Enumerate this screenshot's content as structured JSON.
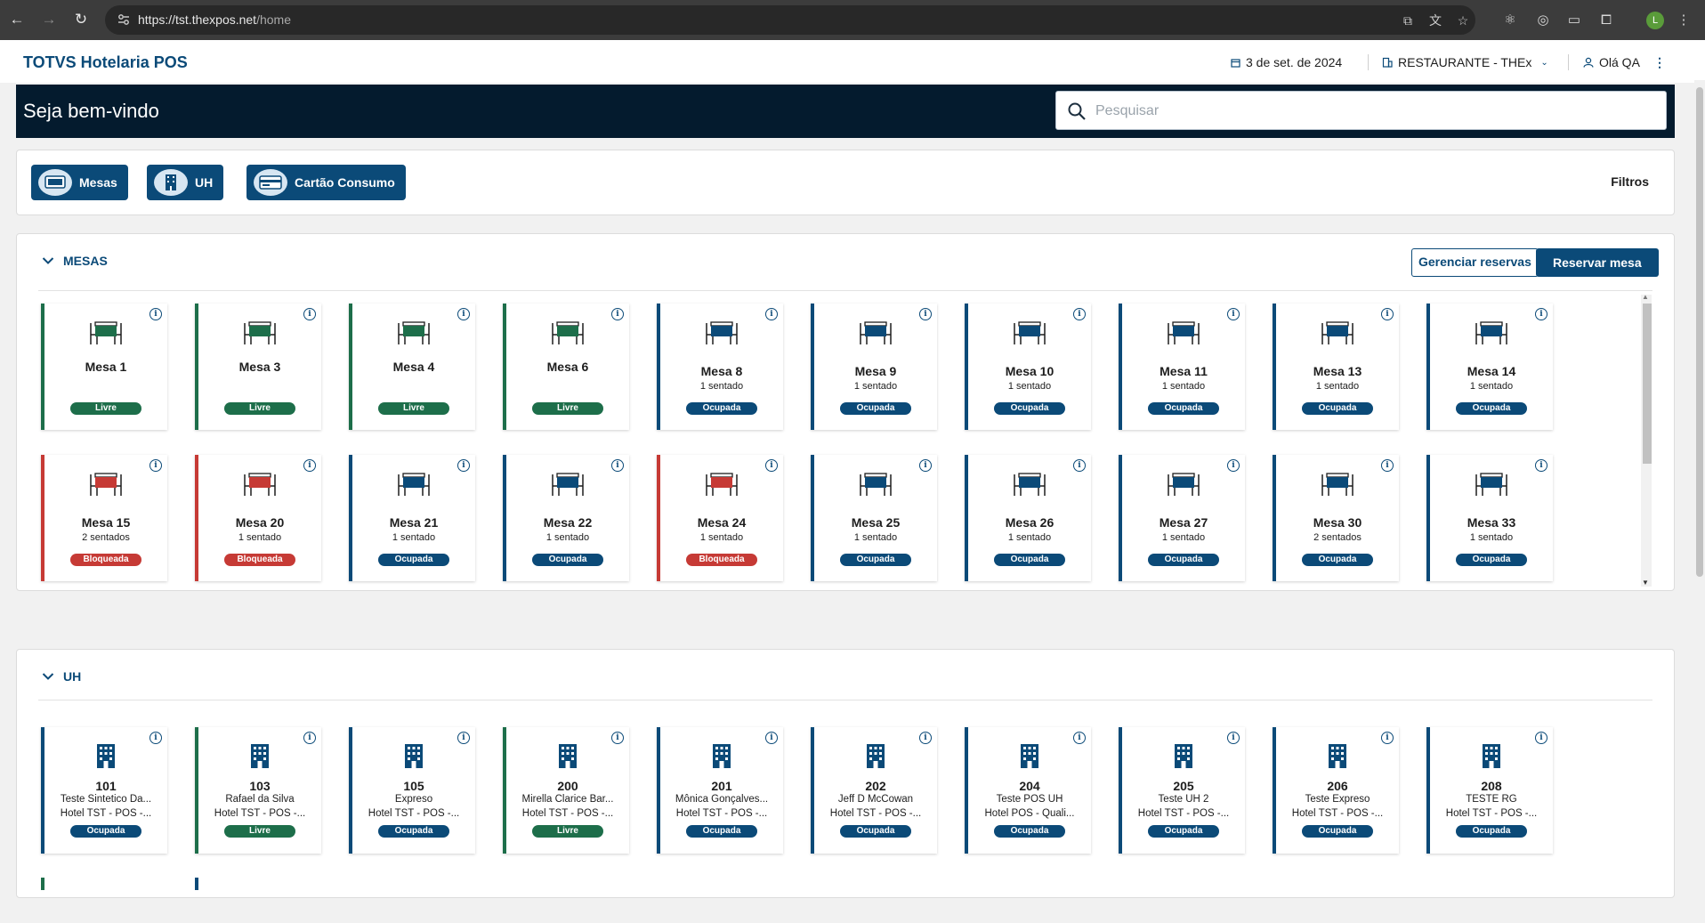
{
  "browser": {
    "url_host": "https://tst.thexpos.net",
    "url_path": "/home",
    "avatar_letter": "L"
  },
  "topbar": {
    "brand": "TOTVS Hotelaria POS",
    "date": "3 de set. de 2024",
    "location": "RESTAURANTE - THEx",
    "user": "Olá QA"
  },
  "banner": {
    "title": "Seja bem-vindo",
    "search_placeholder": "Pesquisar"
  },
  "filters": {
    "buttons": [
      "Mesas",
      "UH",
      "Cartão Consumo"
    ],
    "filtros_label": "Filtros"
  },
  "mesas": {
    "section_title": "MESAS",
    "manage_label": "Gerenciar reservas",
    "reserve_label": "Reservar mesa",
    "cards": [
      {
        "name": "Mesa 1",
        "sub": "",
        "status": "Livre",
        "kind": "livre"
      },
      {
        "name": "Mesa 3",
        "sub": "",
        "status": "Livre",
        "kind": "livre"
      },
      {
        "name": "Mesa 4",
        "sub": "",
        "status": "Livre",
        "kind": "livre"
      },
      {
        "name": "Mesa 6",
        "sub": "",
        "status": "Livre",
        "kind": "livre"
      },
      {
        "name": "Mesa 8",
        "sub": "1 sentado",
        "status": "Ocupada",
        "kind": "ocupada"
      },
      {
        "name": "Mesa 9",
        "sub": "1 sentado",
        "status": "Ocupada",
        "kind": "ocupada"
      },
      {
        "name": "Mesa 10",
        "sub": "1 sentado",
        "status": "Ocupada",
        "kind": "ocupada"
      },
      {
        "name": "Mesa 11",
        "sub": "1 sentado",
        "status": "Ocupada",
        "kind": "ocupada"
      },
      {
        "name": "Mesa 13",
        "sub": "1 sentado",
        "status": "Ocupada",
        "kind": "ocupada"
      },
      {
        "name": "Mesa 14",
        "sub": "1 sentado",
        "status": "Ocupada",
        "kind": "ocupada"
      },
      {
        "name": "Mesa 15",
        "sub": "2 sentados",
        "status": "Bloqueada",
        "kind": "bloqueada"
      },
      {
        "name": "Mesa 20",
        "sub": "1 sentado",
        "status": "Bloqueada",
        "kind": "bloqueada"
      },
      {
        "name": "Mesa 21",
        "sub": "1 sentado",
        "status": "Ocupada",
        "kind": "ocupada"
      },
      {
        "name": "Mesa 22",
        "sub": "1 sentado",
        "status": "Ocupada",
        "kind": "ocupada"
      },
      {
        "name": "Mesa 24",
        "sub": "1 sentado",
        "status": "Bloqueada",
        "kind": "bloqueada"
      },
      {
        "name": "Mesa 25",
        "sub": "1 sentado",
        "status": "Ocupada",
        "kind": "ocupada"
      },
      {
        "name": "Mesa 26",
        "sub": "1 sentado",
        "status": "Ocupada",
        "kind": "ocupada"
      },
      {
        "name": "Mesa 27",
        "sub": "1 sentado",
        "status": "Ocupada",
        "kind": "ocupada"
      },
      {
        "name": "Mesa 30",
        "sub": "2 sentados",
        "status": "Ocupada",
        "kind": "ocupada"
      },
      {
        "name": "Mesa 33",
        "sub": "1 sentado",
        "status": "Ocupada",
        "kind": "ocupada"
      }
    ]
  },
  "uh": {
    "section_title": "UH",
    "cards": [
      {
        "name": "101",
        "guest": "Teste Sintetico Da...",
        "hotel": "Hotel TST - POS -...",
        "status": "Ocupada",
        "kind": "ocupada"
      },
      {
        "name": "103",
        "guest": "Rafael da Silva",
        "hotel": "Hotel TST - POS -...",
        "status": "Livre",
        "kind": "livre"
      },
      {
        "name": "105",
        "guest": "Expreso",
        "hotel": "Hotel TST - POS -...",
        "status": "Ocupada",
        "kind": "ocupada"
      },
      {
        "name": "200",
        "guest": "Mirella Clarice Bar...",
        "hotel": "Hotel TST - POS -...",
        "status": "Livre",
        "kind": "livre"
      },
      {
        "name": "201",
        "guest": "Mônica Gonçalves...",
        "hotel": "Hotel TST - POS -...",
        "status": "Ocupada",
        "kind": "ocupada"
      },
      {
        "name": "202",
        "guest": "Jeff D McCowan",
        "hotel": "Hotel TST - POS -...",
        "status": "Ocupada",
        "kind": "ocupada"
      },
      {
        "name": "204",
        "guest": "Teste POS UH",
        "hotel": "Hotel POS - Quali...",
        "status": "Ocupada",
        "kind": "ocupada"
      },
      {
        "name": "205",
        "guest": "Teste UH 2",
        "hotel": "Hotel TST - POS -...",
        "status": "Ocupada",
        "kind": "ocupada"
      },
      {
        "name": "206",
        "guest": "Teste Expreso",
        "hotel": "Hotel TST - POS -...",
        "status": "Ocupada",
        "kind": "ocupada"
      },
      {
        "name": "208",
        "guest": "TESTE RG",
        "hotel": "Hotel TST - POS -...",
        "status": "Ocupada",
        "kind": "ocupada"
      }
    ]
  },
  "colors": {
    "primary": "#0b4a78",
    "livre": "#1d6e4a",
    "bloqueada": "#c63a35",
    "banner": "#041b2e"
  }
}
